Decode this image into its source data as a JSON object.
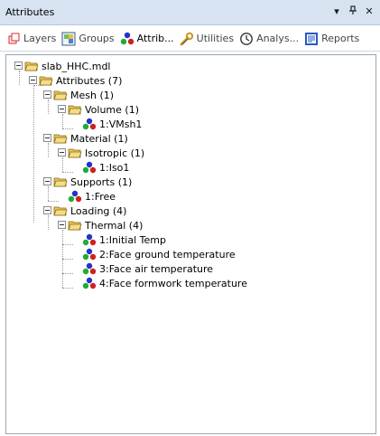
{
  "window": {
    "title": "Attributes"
  },
  "titlebar_buttons": [
    {
      "name": "dropdown-icon",
      "glyph": "▾"
    },
    {
      "name": "pin-icon",
      "glyph": "ᵽ"
    },
    {
      "name": "close-icon",
      "glyph": "✕"
    }
  ],
  "tabs": [
    {
      "id": "layers",
      "label": "Layers",
      "icon": "layers-icon",
      "active": false
    },
    {
      "id": "groups",
      "label": "Groups",
      "icon": "groups-icon",
      "active": false
    },
    {
      "id": "attributes",
      "label": "Attrib...",
      "icon": "attributes-icon",
      "active": true
    },
    {
      "id": "utilities",
      "label": "Utilities",
      "icon": "wrench-icon",
      "active": false
    },
    {
      "id": "analyses",
      "label": "Analys...",
      "icon": "clock-icon",
      "active": false
    },
    {
      "id": "reports",
      "label": "Reports",
      "icon": "report-icon",
      "active": false
    }
  ],
  "tree": {
    "root": "slab_HHC.mdl",
    "attributes": "Attributes (7)",
    "mesh": "Mesh (1)",
    "volume": "Volume (1)",
    "vmsh": "1:VMsh1",
    "material": "Material (1)",
    "isotropic": "Isotropic (1)",
    "iso": "1:Iso1",
    "supports": "Supports (1)",
    "free": "1:Free",
    "loading": "Loading (4)",
    "thermal": "Thermal (4)",
    "t1": "1:Initial Temp",
    "t2": "2:Face ground temperature",
    "t3": "3:Face air temperature",
    "t4": "4:Face formwork temperature"
  },
  "colors": {
    "titlebar": "#d7e3f1",
    "folder": "#e9c75c",
    "attr_red": "#cc2222",
    "attr_green": "#22aa33",
    "attr_blue": "#2233cc"
  }
}
